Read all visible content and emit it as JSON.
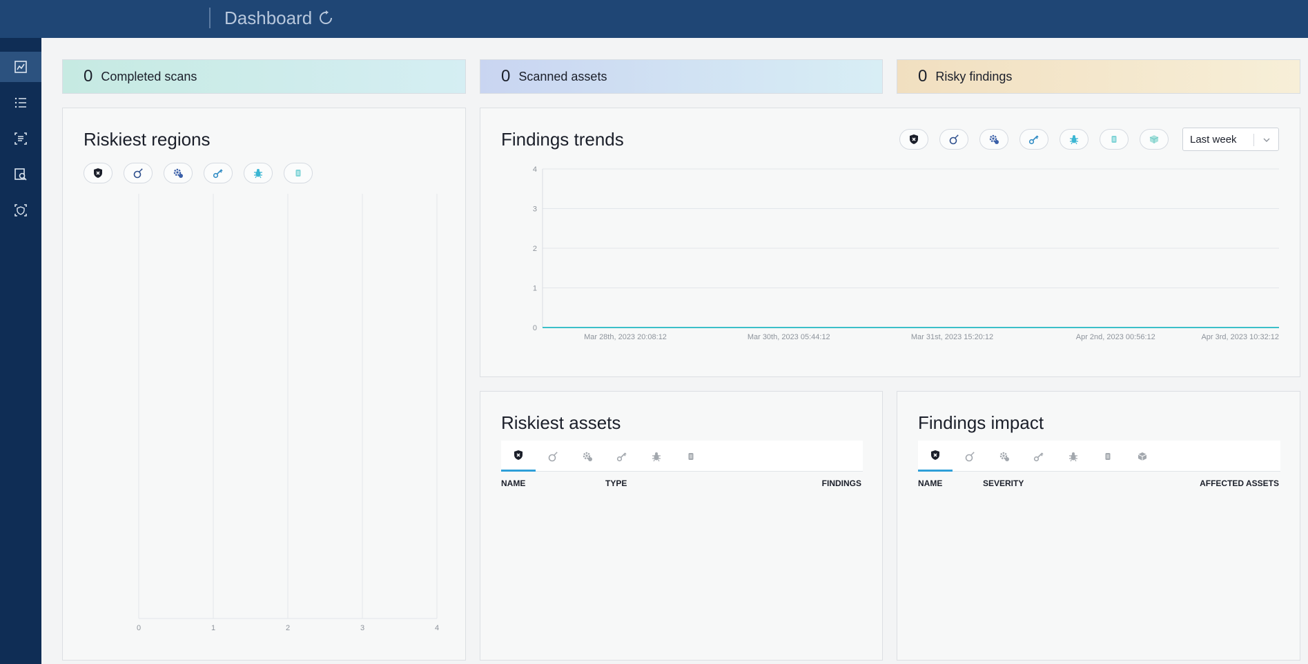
{
  "header": {
    "title": "Dashboard"
  },
  "stats": [
    {
      "value": "0",
      "label": "Completed scans"
    },
    {
      "value": "0",
      "label": "Scanned assets"
    },
    {
      "value": "0",
      "label": "Risky findings"
    }
  ],
  "riskiest_regions": {
    "title": "Riskiest regions",
    "filters": [
      "vulnerabilities-icon",
      "exploits-icon",
      "misconfigurations-icon",
      "secrets-icon",
      "malware-icon",
      "rootkits-icon"
    ],
    "x_ticks": [
      "0",
      "1",
      "2",
      "3",
      "4"
    ]
  },
  "findings_trends": {
    "title": "Findings trends",
    "range_select": "Last week",
    "filters": [
      "vulnerabilities-icon",
      "exploits-icon",
      "misconfigurations-icon",
      "secrets-icon",
      "malware-icon",
      "rootkits-icon",
      "packages-icon"
    ]
  },
  "riskiest_assets": {
    "title": "Riskiest assets",
    "columns": [
      "NAME",
      "TYPE",
      "FINDINGS"
    ]
  },
  "findings_impact": {
    "title": "Findings impact",
    "columns": [
      "NAME",
      "SEVERITY",
      "AFFECTED ASSETS"
    ]
  },
  "chart_data": {
    "type": "line",
    "x": [
      "Mar 28th, 2023 20:08:12",
      "Mar 30th, 2023 05:44:12",
      "Mar 31st, 2023 15:20:12",
      "Apr 2nd, 2023 00:56:12",
      "Apr 3rd, 2023 10:32:12"
    ],
    "y_ticks": [
      "0",
      "1",
      "2",
      "3",
      "4"
    ],
    "series": [
      {
        "values": [
          0,
          0,
          0,
          0,
          0
        ]
      }
    ],
    "ylim": [
      0,
      4
    ],
    "grid": true,
    "colors": {
      "line": "#3bbfc9"
    }
  }
}
